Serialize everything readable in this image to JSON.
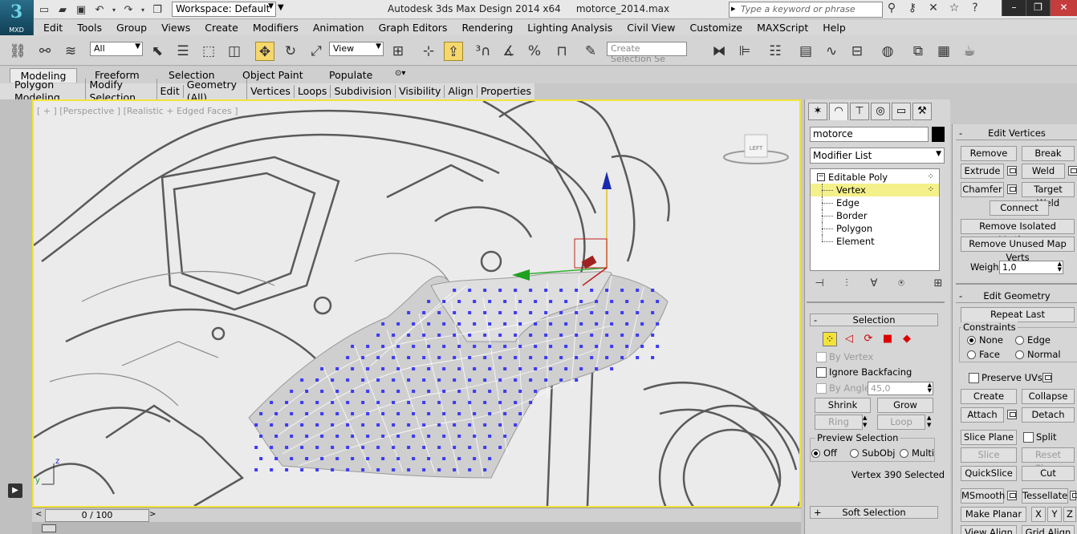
{
  "app": {
    "title": "Autodesk 3ds Max Design 2014 x64     motorce_2014.max",
    "logo_text": "MXD",
    "workspace": "Workspace: Default",
    "search_placeholder": "Type a keyword or phrase"
  },
  "menu": [
    "Edit",
    "Tools",
    "Group",
    "Views",
    "Create",
    "Modifiers",
    "Animation",
    "Graph Editors",
    "Rendering",
    "Lighting Analysis",
    "Civil View",
    "Customize",
    "MAXScript",
    "Help"
  ],
  "toolbar": {
    "selection_filter": "All",
    "reference_coord": "View",
    "named_selection_placeholder": "Create Selection Se"
  },
  "ribbon": {
    "tabs": [
      "Modeling",
      "Freeform",
      "Selection",
      "Object Paint",
      "Populate"
    ],
    "subtabs": [
      "Polygon Modeling",
      "Modify Selection",
      "Edit",
      "Geometry (All)",
      "Vertices",
      "Loops",
      "Subdivision",
      "Visibility",
      "Align",
      "Properties"
    ]
  },
  "viewport": {
    "label": "[ + ] [Perspective ] [Realistic + Edged Faces ]",
    "viewcube_label": "LEFT",
    "axis_z": "z",
    "axis_y": "y"
  },
  "timeline": {
    "frame": "0 / 100",
    "prev": "<",
    "next": ">"
  },
  "command_panel": {
    "object_name": "motorce",
    "object_color": "#000000",
    "modifier_list": "Modifier List",
    "stack": {
      "root": "Editable Poly",
      "items": [
        "Vertex",
        "Edge",
        "Border",
        "Polygon",
        "Element"
      ],
      "selected": "Vertex"
    },
    "selection": {
      "header": "Selection",
      "by_vertex": "By Vertex",
      "ignore_backfacing": "Ignore Backfacing",
      "by_angle": "By Angle:",
      "angle_value": "45,0",
      "shrink": "Shrink",
      "grow": "Grow",
      "ring": "Ring",
      "loop": "Loop",
      "preview_selection": "Preview Selection",
      "preview_off": "Off",
      "preview_subobj": "SubObj",
      "preview_multi": "Multi",
      "status": "Vertex 390 Selected"
    },
    "soft_selection": "Soft Selection"
  },
  "edit_vertices": {
    "header": "Edit Vertices",
    "remove": "Remove",
    "break": "Break",
    "extrude": "Extrude",
    "weld": "Weld",
    "chamfer": "Chamfer",
    "target_weld": "Target Weld",
    "connect": "Connect",
    "remove_isolated": "Remove Isolated Vertices",
    "remove_unused": "Remove Unused Map Verts",
    "weight_label": "Weight:",
    "weight_value": "1,0"
  },
  "edit_geometry": {
    "header": "Edit Geometry",
    "repeat_last": "Repeat Last",
    "constraints": "Constraints",
    "none": "None",
    "edge": "Edge",
    "face": "Face",
    "normal": "Normal",
    "preserve_uvs": "Preserve UVs",
    "create": "Create",
    "collapse": "Collapse",
    "attach": "Attach",
    "detach": "Detach",
    "slice_plane": "Slice Plane",
    "split": "Split",
    "slice": "Slice",
    "reset_plane": "Reset Plane",
    "quickslice": "QuickSlice",
    "cut": "Cut",
    "msmooth": "MSmooth",
    "tessellate": "Tessellate",
    "make_planar": "Make Planar",
    "x": "X",
    "y": "Y",
    "z": "Z",
    "view_align": "View Align",
    "grid_align": "Grid Align"
  },
  "colors": {
    "viewport_border": "#f2e33a",
    "vertex_blue": "#3b3bf5",
    "selected_item": "#f4f08a"
  }
}
